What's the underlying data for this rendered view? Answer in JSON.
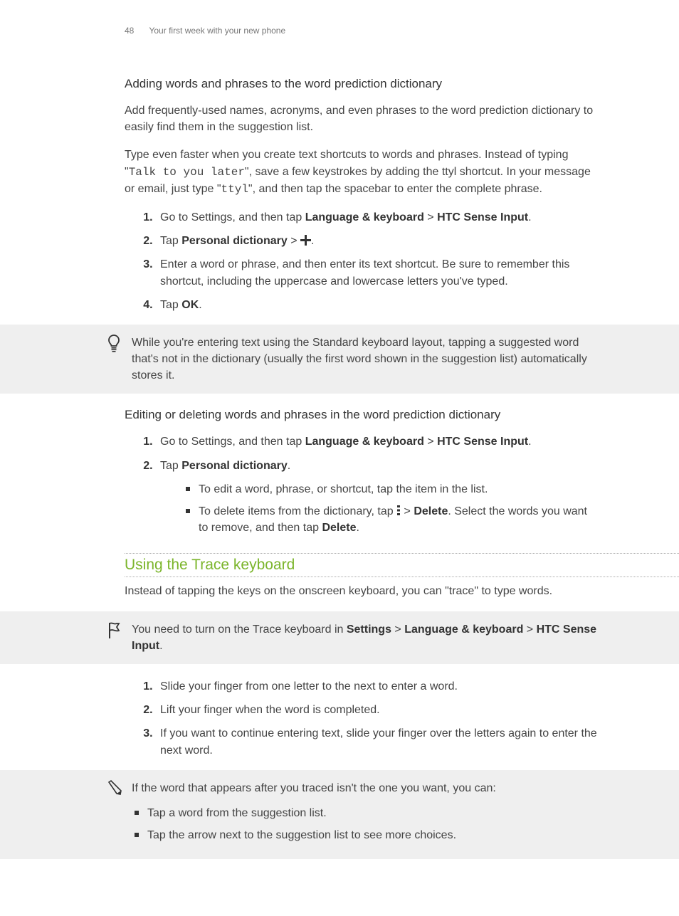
{
  "header": {
    "page_number": "48",
    "section": "Your first week with your new phone"
  },
  "s1": {
    "heading": "Adding words and phrases to the word prediction dictionary",
    "p1": "Add frequently-used names, acronyms, and even phrases to the word prediction dictionary to easily find them in the suggestion list.",
    "p2a": "Type even faster when you create text shortcuts to words and phrases. Instead of typing \"",
    "p2_mono1": "Talk to you later",
    "p2b": "\", save a few keystrokes by adding the ttyl shortcut. In your message or email, just type \"",
    "p2_mono2": "ttyl",
    "p2c": "\", and then tap the spacebar to enter the complete phrase.",
    "step1a": "Go to Settings, and then tap ",
    "step1_b1": "Language & keyboard",
    "step1b": " > ",
    "step1_b2": "HTC Sense Input",
    "step1c": ".",
    "step2a": "Tap ",
    "step2_b1": "Personal dictionary",
    "step2b": " > ",
    "step2c": ".",
    "step3": "Enter a word or phrase, and then enter its text shortcut. Be sure to remember this shortcut, including the uppercase and lowercase letters you've typed.",
    "step4a": "Tap ",
    "step4_b1": "OK",
    "step4b": "."
  },
  "tip1": "While you're entering text using the Standard keyboard layout, tapping a suggested word that's not in the dictionary (usually the first word shown in the suggestion list) automatically stores it.",
  "s2": {
    "heading": "Editing or deleting words and phrases in the word prediction dictionary",
    "step1a": "Go to Settings, and then tap ",
    "step1_b1": "Language & keyboard",
    "step1b": " > ",
    "step1_b2": "HTC Sense Input",
    "step1c": ".",
    "step2a": "Tap ",
    "step2_b1": "Personal dictionary",
    "step2b": ".",
    "sub1": "To edit a word, phrase, or shortcut, tap the item in the list.",
    "sub2a": "To delete items from the dictionary, tap ",
    "sub2b": " > ",
    "sub2_b1": "Delete",
    "sub2c": ". Select the words you want to remove, and then tap ",
    "sub2_b2": "Delete",
    "sub2d": "."
  },
  "s3": {
    "title": "Using the Trace keyboard",
    "p1": "Instead of tapping the keys on the onscreen keyboard, you can \"trace\" to type words.",
    "note_a": "You need to turn on the Trace keyboard in ",
    "note_b1": "Settings",
    "note_b": " > ",
    "note_b2": "Language & keyboard",
    "note_c": " > ",
    "note_b3": "HTC Sense Input",
    "note_d": ".",
    "step1": "Slide your finger from one letter to the next to enter a word.",
    "step2": "Lift your finger when the word is completed.",
    "step3": "If you want to continue entering text, slide your finger over the letters again to enter the next word.",
    "tip_intro": "If the word that appears after you traced isn't the one you want, you can:",
    "tip_s1": "Tap a word from the suggestion list.",
    "tip_s2": "Tap the arrow next to the suggestion list to see more choices."
  }
}
